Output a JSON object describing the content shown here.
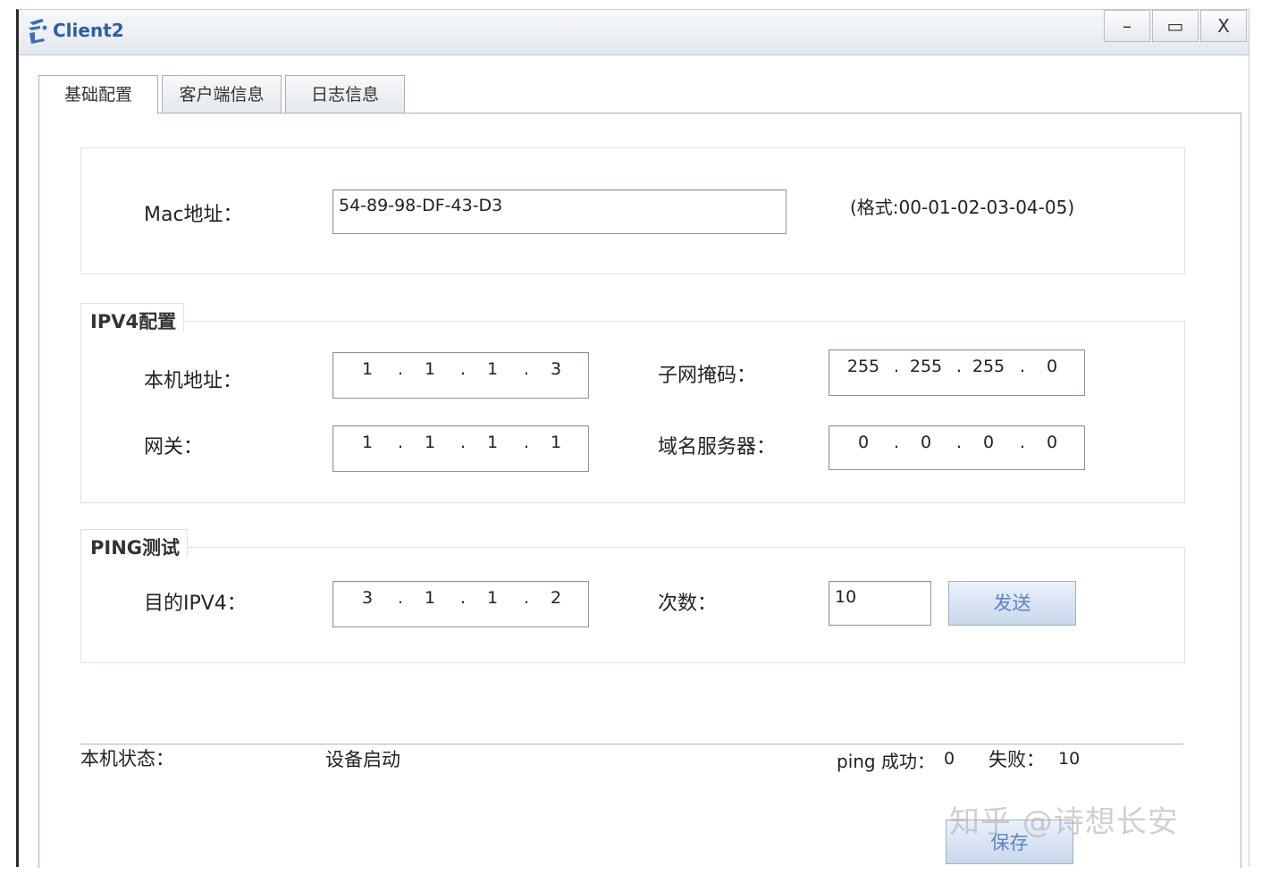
{
  "window": {
    "title": "Client2",
    "controls": {
      "minimize": "–",
      "maximize": "▭",
      "close": "X"
    }
  },
  "tabs": [
    {
      "label": "基础配置",
      "active": true
    },
    {
      "label": "客户端信息",
      "active": false
    },
    {
      "label": "日志信息",
      "active": false
    }
  ],
  "mac": {
    "label": "Mac地址：",
    "value": "54-89-98-DF-43-D3",
    "format_hint": "(格式:00-01-02-03-04-05)"
  },
  "ipv4": {
    "group_label": "IPV4配置",
    "host_label": "本机地址：",
    "host": [
      "1",
      "1",
      "1",
      "3"
    ],
    "mask_label": "子网掩码：",
    "mask": [
      "255",
      "255",
      "255",
      "0"
    ],
    "gateway_label": "网关：",
    "gateway": [
      "1",
      "1",
      "1",
      "1"
    ],
    "dns_label": "域名服务器：",
    "dns": [
      "0",
      "0",
      "0",
      "0"
    ]
  },
  "ping": {
    "group_label": "PING测试",
    "target_label": "目的IPV4：",
    "target": [
      "3",
      "1",
      "1",
      "2"
    ],
    "count_label": "次数：",
    "count": "10",
    "send_button": "发送"
  },
  "status": {
    "label": "本机状态：",
    "value": "设备启动",
    "ping_success_label": "ping 成功：",
    "ping_success": "0",
    "fail_label": "失败：",
    "fail": "10"
  },
  "save_button": "保存",
  "watermark": "知乎 @诗想长安",
  "colors": {
    "title_text": "#2d5ea6",
    "button_text": "#5a84c2"
  }
}
